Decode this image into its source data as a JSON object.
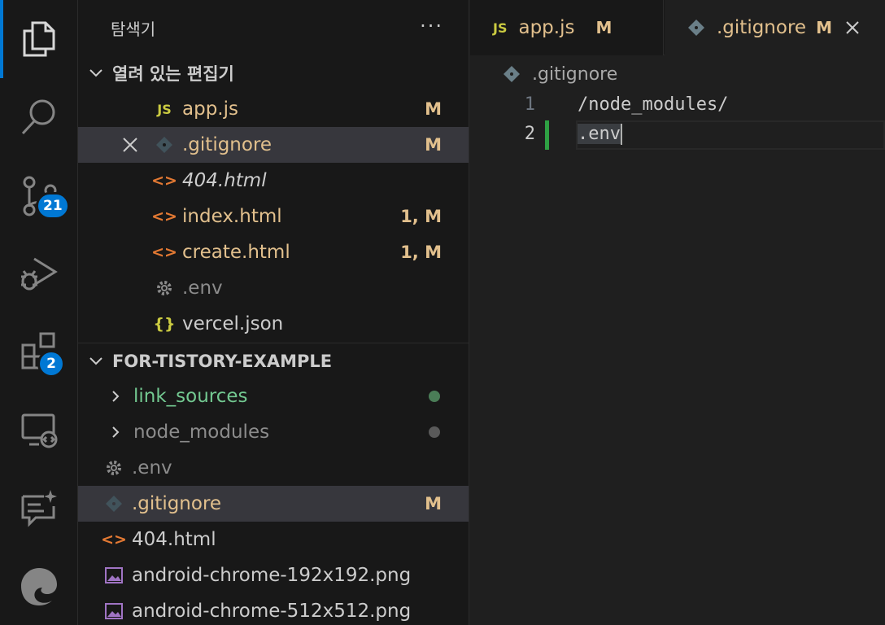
{
  "activity": {
    "scm_badge": "21",
    "extensions_badge": "2"
  },
  "sidebar": {
    "title": "탐색기",
    "more": "···",
    "open_editors": {
      "header": "열려 있는 편집기",
      "items": [
        {
          "icon": "JS",
          "name": "app.js",
          "status": "M"
        },
        {
          "icon": "git",
          "name": ".gitignore",
          "status": "M"
        },
        {
          "icon": "<>",
          "name": "404.html",
          "status": ""
        },
        {
          "icon": "<>",
          "name": "index.html",
          "status": "1, M"
        },
        {
          "icon": "<>",
          "name": "create.html",
          "status": "1, M"
        },
        {
          "icon": "gear",
          "name": ".env",
          "status": ""
        },
        {
          "icon": "{}",
          "name": "vercel.json",
          "status": ""
        }
      ]
    },
    "project": {
      "header": "FOR-TISTORY-EXAMPLE",
      "items": [
        {
          "name": "link_sources",
          "type": "folder"
        },
        {
          "name": "node_modules",
          "type": "folder"
        },
        {
          "name": ".env",
          "type": "file"
        },
        {
          "name": ".gitignore",
          "type": "file",
          "status": "M"
        },
        {
          "name": "404.html",
          "type": "file"
        },
        {
          "name": "android-chrome-192x192.png",
          "type": "file"
        },
        {
          "name": "android-chrome-512x512.png",
          "type": "file"
        }
      ]
    }
  },
  "editor": {
    "tabs": [
      {
        "icon": "JS",
        "label": "app.js",
        "mark": "M"
      },
      {
        "label": ".gitignore",
        "mark": "M"
      }
    ],
    "breadcrumb": ".gitignore",
    "lines": [
      {
        "num": "1",
        "text": "/node_modules/"
      },
      {
        "num": "2",
        "text": ".env"
      }
    ]
  },
  "colors": {
    "accent": "#0078d4",
    "modified": "#e2c08d",
    "untracked": "#73c991",
    "added_gutter": "#2ea043"
  }
}
